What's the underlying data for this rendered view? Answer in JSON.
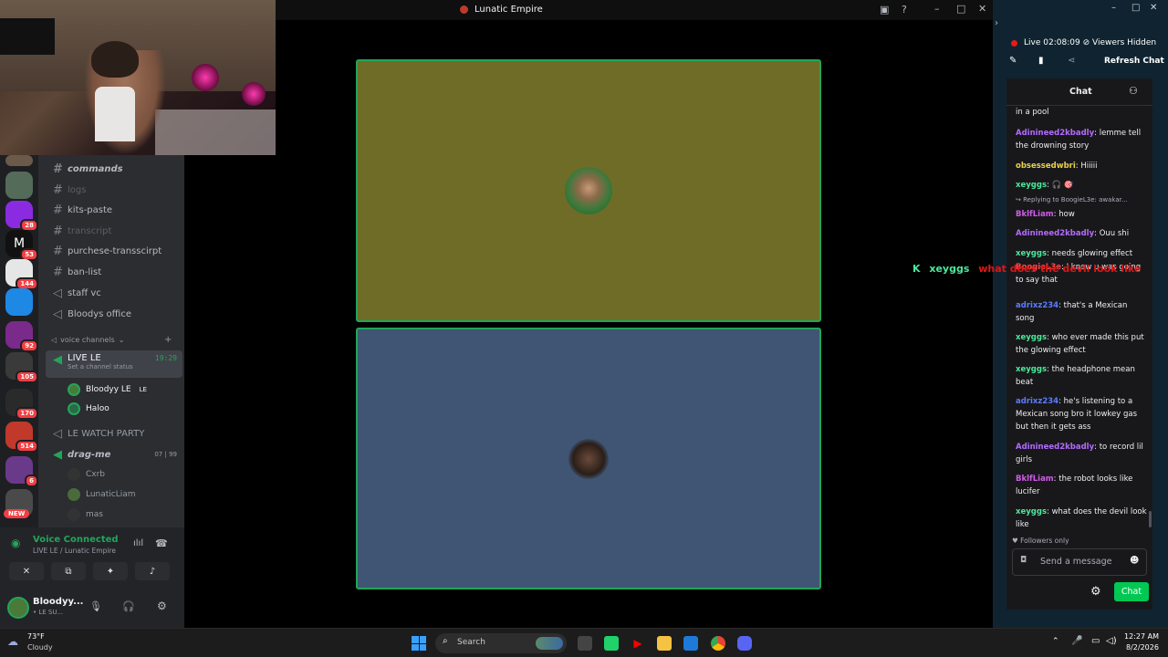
{
  "window": {
    "title": "Lunatic Empire"
  },
  "server_rail": {
    "badges": [
      "28",
      "53",
      "144",
      "92",
      "105",
      "170",
      "514",
      "6",
      "NEW"
    ]
  },
  "channels": {
    "text": [
      {
        "label": "commands",
        "style": "bold"
      },
      {
        "label": "logs",
        "style": "dim"
      },
      {
        "label": "kits-paste",
        "style": "normal"
      },
      {
        "label": "transcript",
        "style": "dim"
      },
      {
        "label": "purchese-transscirpt",
        "style": "normal"
      },
      {
        "label": "ban-list",
        "style": "normal"
      },
      {
        "label": "staff vc",
        "style": "normal"
      },
      {
        "label": "Bloodys office",
        "style": "normal"
      }
    ],
    "voice_category": "voice channels",
    "live_channel": {
      "label": "LIVE LE",
      "status": "Set a channel status",
      "timer": "19:29"
    },
    "live_users": [
      {
        "name": "Bloodyy LE",
        "tag": "LE"
      },
      {
        "name": "Haloo",
        "tag": ""
      }
    ],
    "watch_party": "LE WATCH PARTY",
    "drag_me": {
      "label": "drag-me",
      "count_a": "07",
      "count_b": "99"
    },
    "drag_users": [
      "Cxrb",
      "LunaticLiam",
      "mas"
    ]
  },
  "voice_panel": {
    "status": "Voice Connected",
    "location": "LIVE LE / Lunatic Empire",
    "username": "Bloodyy...",
    "substatus": "• LE SU..."
  },
  "right_panel": {
    "live_label": "Live",
    "live_time": "02:08:09",
    "viewers": "Viewers Hidden",
    "refresh": "Refresh Chat",
    "chat_title": "Chat",
    "followers_only": "Followers only",
    "send_placeholder": "Send a message",
    "chat_button": "Chat"
  },
  "chat_messages": [
    {
      "user": "",
      "text": "in a pool",
      "color": "#efeff1"
    },
    {
      "user": "Adinineed2kbadly",
      "text": ": lemme tell the drowning story",
      "color": "#b36aff"
    },
    {
      "user": "obsessedwbri",
      "text": ": Hiiiii",
      "color": "#e8d24a"
    },
    {
      "user": "xeyggs",
      "text": ": 🎧 🎯",
      "color": "#4de89a"
    },
    {
      "user": "",
      "text": "↪ Replying to BoogieL3e: awakar...",
      "color": "#adadb8"
    },
    {
      "user": "BklfLiam",
      "text": ": how",
      "color": "#d05ce8"
    },
    {
      "user": "Adinineed2kbadly",
      "text": ": Ouu shi",
      "color": "#b36aff"
    },
    {
      "user": "xeyggs",
      "text": ": needs glowing effect",
      "color": "#4de89a"
    },
    {
      "user": "BoogieL3e",
      "text": ": I knew u was going to say that",
      "color": "#ff4a4a"
    },
    {
      "user": "adrixz234",
      "text": ": that's a Mexican song",
      "color": "#5a7cff"
    },
    {
      "user": "xeyggs",
      "text": ": who ever made this put the glowing effect",
      "color": "#4de89a"
    },
    {
      "user": "xeyggs",
      "text": ": the headphone mean beat",
      "color": "#4de89a"
    },
    {
      "user": "adrixz234",
      "text": ": he's listening to a Mexican song bro it lowkey gas but then it gets ass",
      "color": "#5a7cff"
    },
    {
      "user": "Adinineed2kbadly",
      "text": ": to record lil girls",
      "color": "#b36aff"
    },
    {
      "user": "BklfLiam",
      "text": ": the robot looks like lucifer",
      "color": "#d05ce8"
    },
    {
      "user": "xeyggs",
      "text": ": what does the devil look like",
      "color": "#4de89a"
    }
  ],
  "overlay": {
    "user": "xeyggs",
    "text": "what does the devil look like"
  },
  "taskbar": {
    "weather_temp": "73°F",
    "weather_desc": "Cloudy",
    "search": "Search",
    "time": "12:27 AM",
    "date": "8/2/2026"
  }
}
